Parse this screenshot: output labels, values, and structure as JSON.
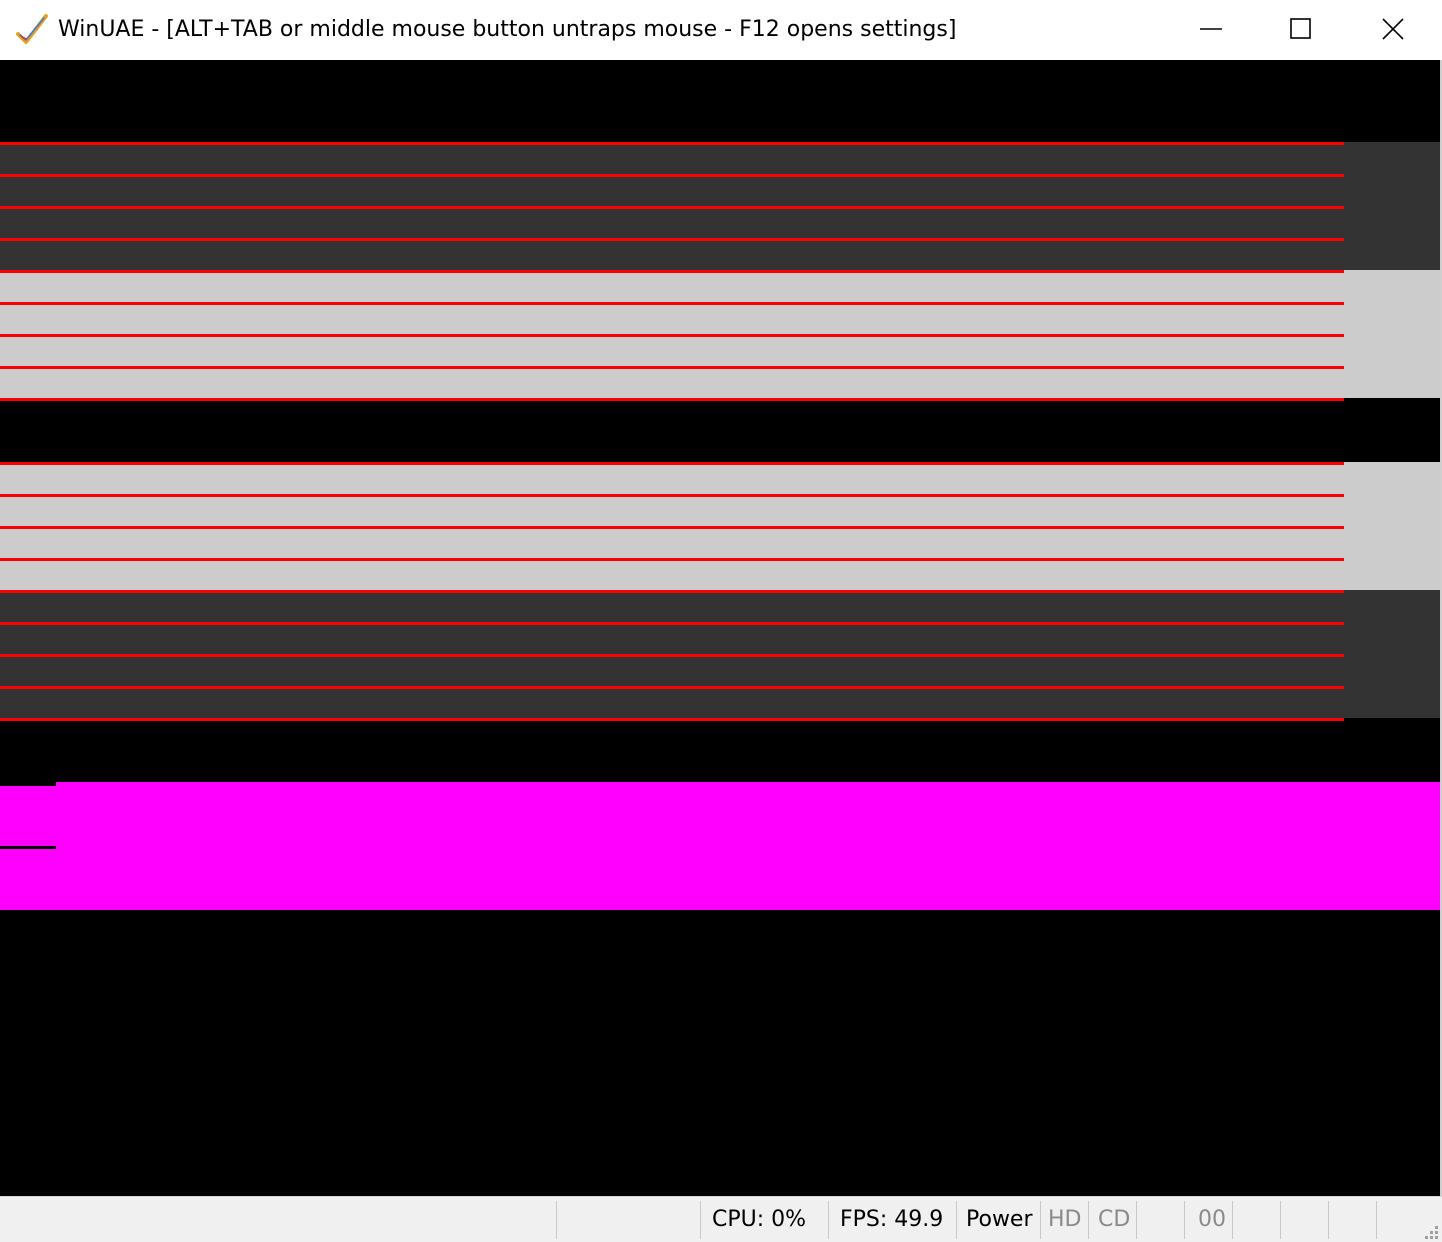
{
  "window": {
    "title": "WinUAE - [ALT+TAB or middle mouse button untraps mouse - F12 opens settings]",
    "icon": "checkmark-app-icon",
    "controls": [
      "minimize-icon",
      "maximize-icon",
      "close-icon"
    ]
  },
  "colors": {
    "dark_band": "#333333",
    "light_band": "#cccccc",
    "stripe": "#ff0000",
    "magenta_band": "#ff00ff",
    "background": "#000000"
  },
  "statusbar": {
    "cpu": "CPU: 0%",
    "fps": "FPS: 49.9",
    "power": "Power",
    "hd": "HD",
    "cd": "CD",
    "drive": "00"
  }
}
